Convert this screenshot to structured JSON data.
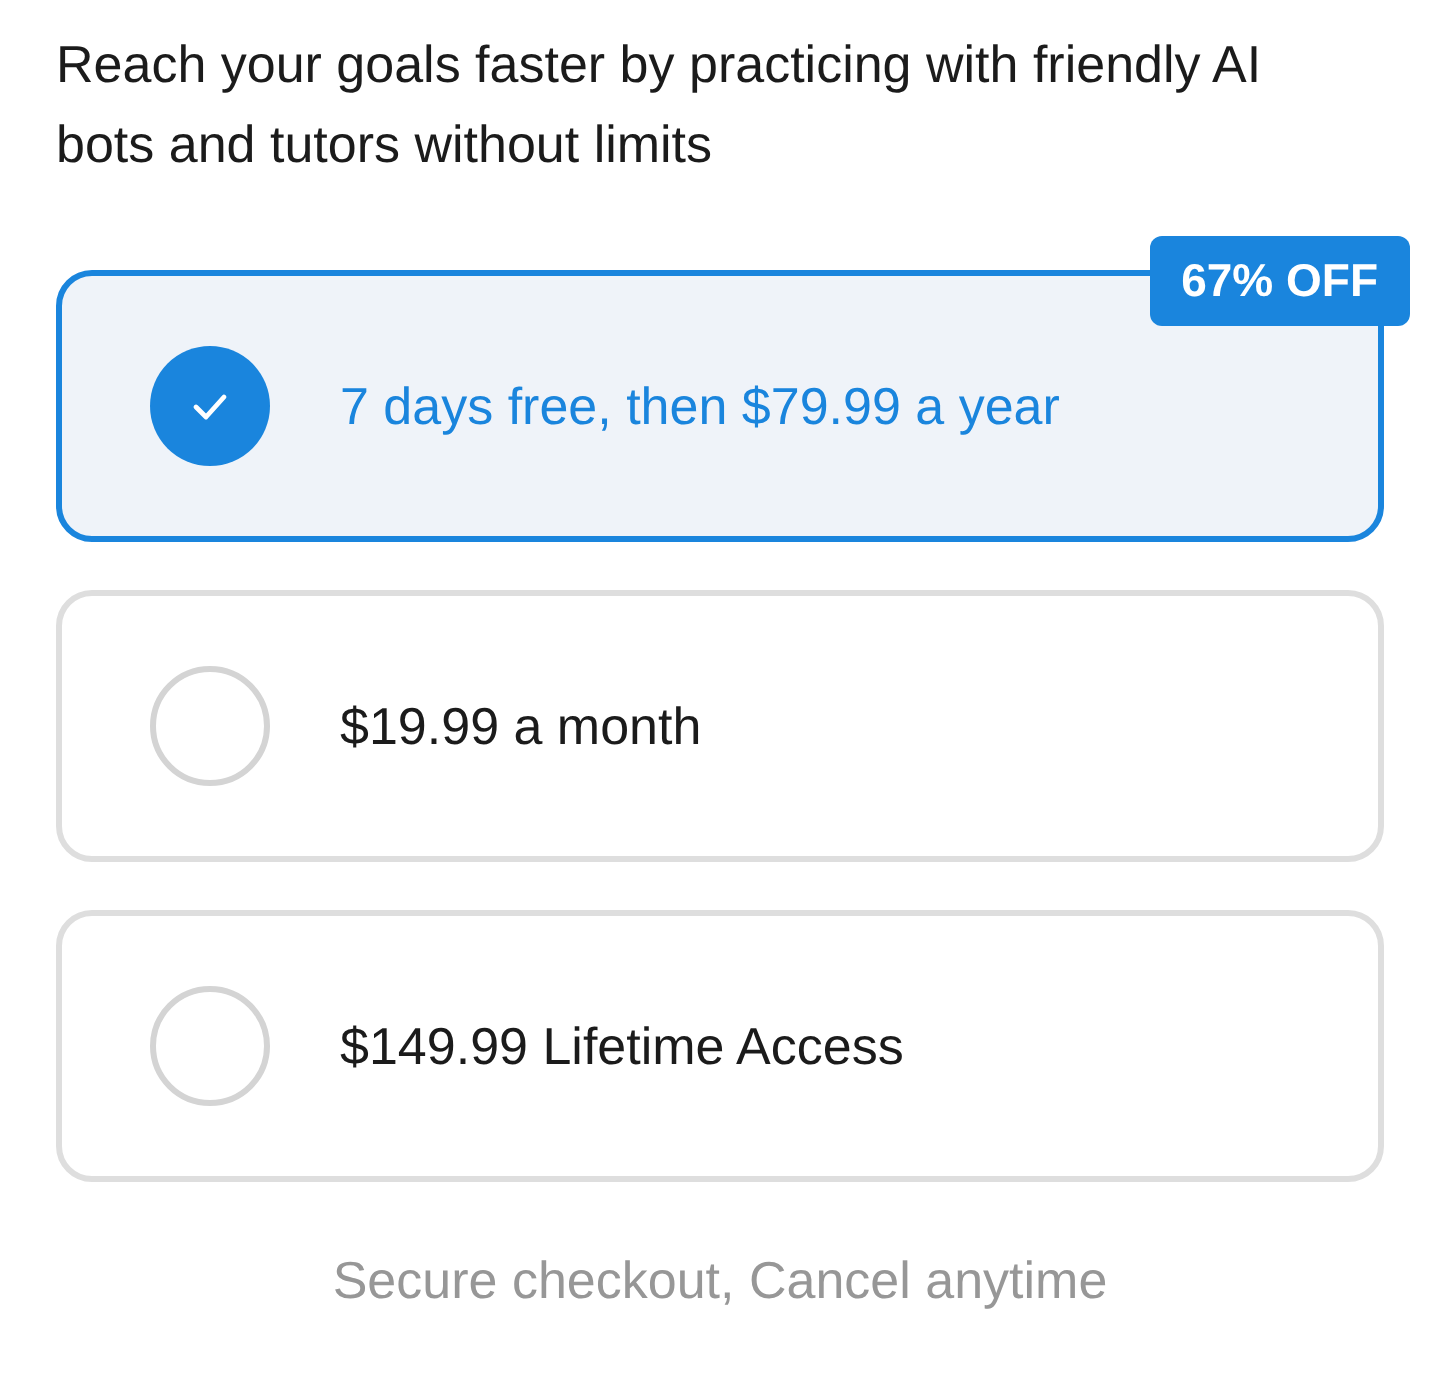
{
  "intro": "Reach your goals faster by practicing with friendly AI bots and tutors without limits",
  "plans": [
    {
      "label": "7 days free, then $79.99 a year",
      "selected": true,
      "badge": "67% OFF"
    },
    {
      "label": "$19.99 a month",
      "selected": false
    },
    {
      "label": "$149.99 Lifetime Access",
      "selected": false
    }
  ],
  "footer": "Secure checkout, Cancel anytime"
}
